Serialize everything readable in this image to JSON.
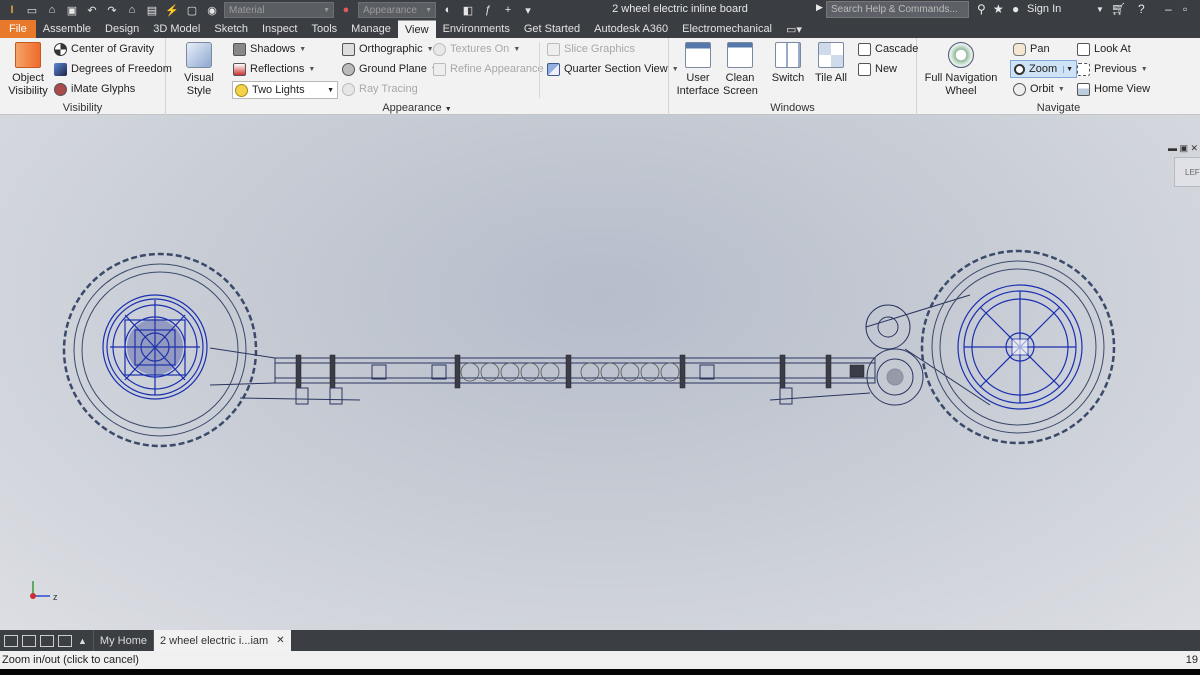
{
  "window": {
    "title": "2 wheel electric inline board",
    "material_dropdown": "Material",
    "appearance_dropdown": "Appearance",
    "search_placeholder": "Search Help & Commands...",
    "sign_in": "Sign In"
  },
  "tabs": [
    "File",
    "Assemble",
    "Design",
    "3D Model",
    "Sketch",
    "Inspect",
    "Tools",
    "Manage",
    "View",
    "Environments",
    "Get Started",
    "Autodesk A360",
    "Electromechanical"
  ],
  "active_tab": "View",
  "ribbon": {
    "visibility": {
      "label": "Visibility",
      "object_visibility": "Object Visibility",
      "center_of_gravity": "Center of Gravity",
      "degrees_of_freedom": "Degrees of Freedom",
      "imate_glyphs": "iMate Glyphs"
    },
    "appearance": {
      "label": "Appearance",
      "visual_style": "Visual Style",
      "shadows": "Shadows",
      "reflections": "Reflections",
      "lighting": "Two Lights",
      "orthographic": "Orthographic",
      "ground_plane": "Ground Plane",
      "ray_tracing": "Ray Tracing",
      "textures_on": "Textures On",
      "refine_appearance": "Refine Appearance",
      "slice_graphics": "Slice Graphics",
      "quarter_section_view": "Quarter Section View"
    },
    "windows": {
      "label": "Windows",
      "user_interface": "User Interface",
      "clean_screen": "Clean Screen",
      "switch": "Switch",
      "tile_all": "Tile All",
      "cascade": "Cascade",
      "new": "New"
    },
    "navigate": {
      "label": "Navigate",
      "full_navigation_wheel": "Full Navigation Wheel",
      "pan": "Pan",
      "zoom": "Zoom",
      "orbit": "Orbit",
      "look_at": "Look At",
      "previous": "Previous",
      "home_view": "Home View"
    }
  },
  "viewport": {
    "viewcube_label": "LEF",
    "axis_z": "z"
  },
  "doc_tabs": [
    "My Home",
    "2 wheel electric i...iam"
  ],
  "status": {
    "message": "Zoom in/out (click to cancel)",
    "right_value": "19"
  },
  "colors": {
    "title_bar": "#3a3d42",
    "file_tab": "#e8782a",
    "wireframe_blue": "#1a2fb0"
  }
}
